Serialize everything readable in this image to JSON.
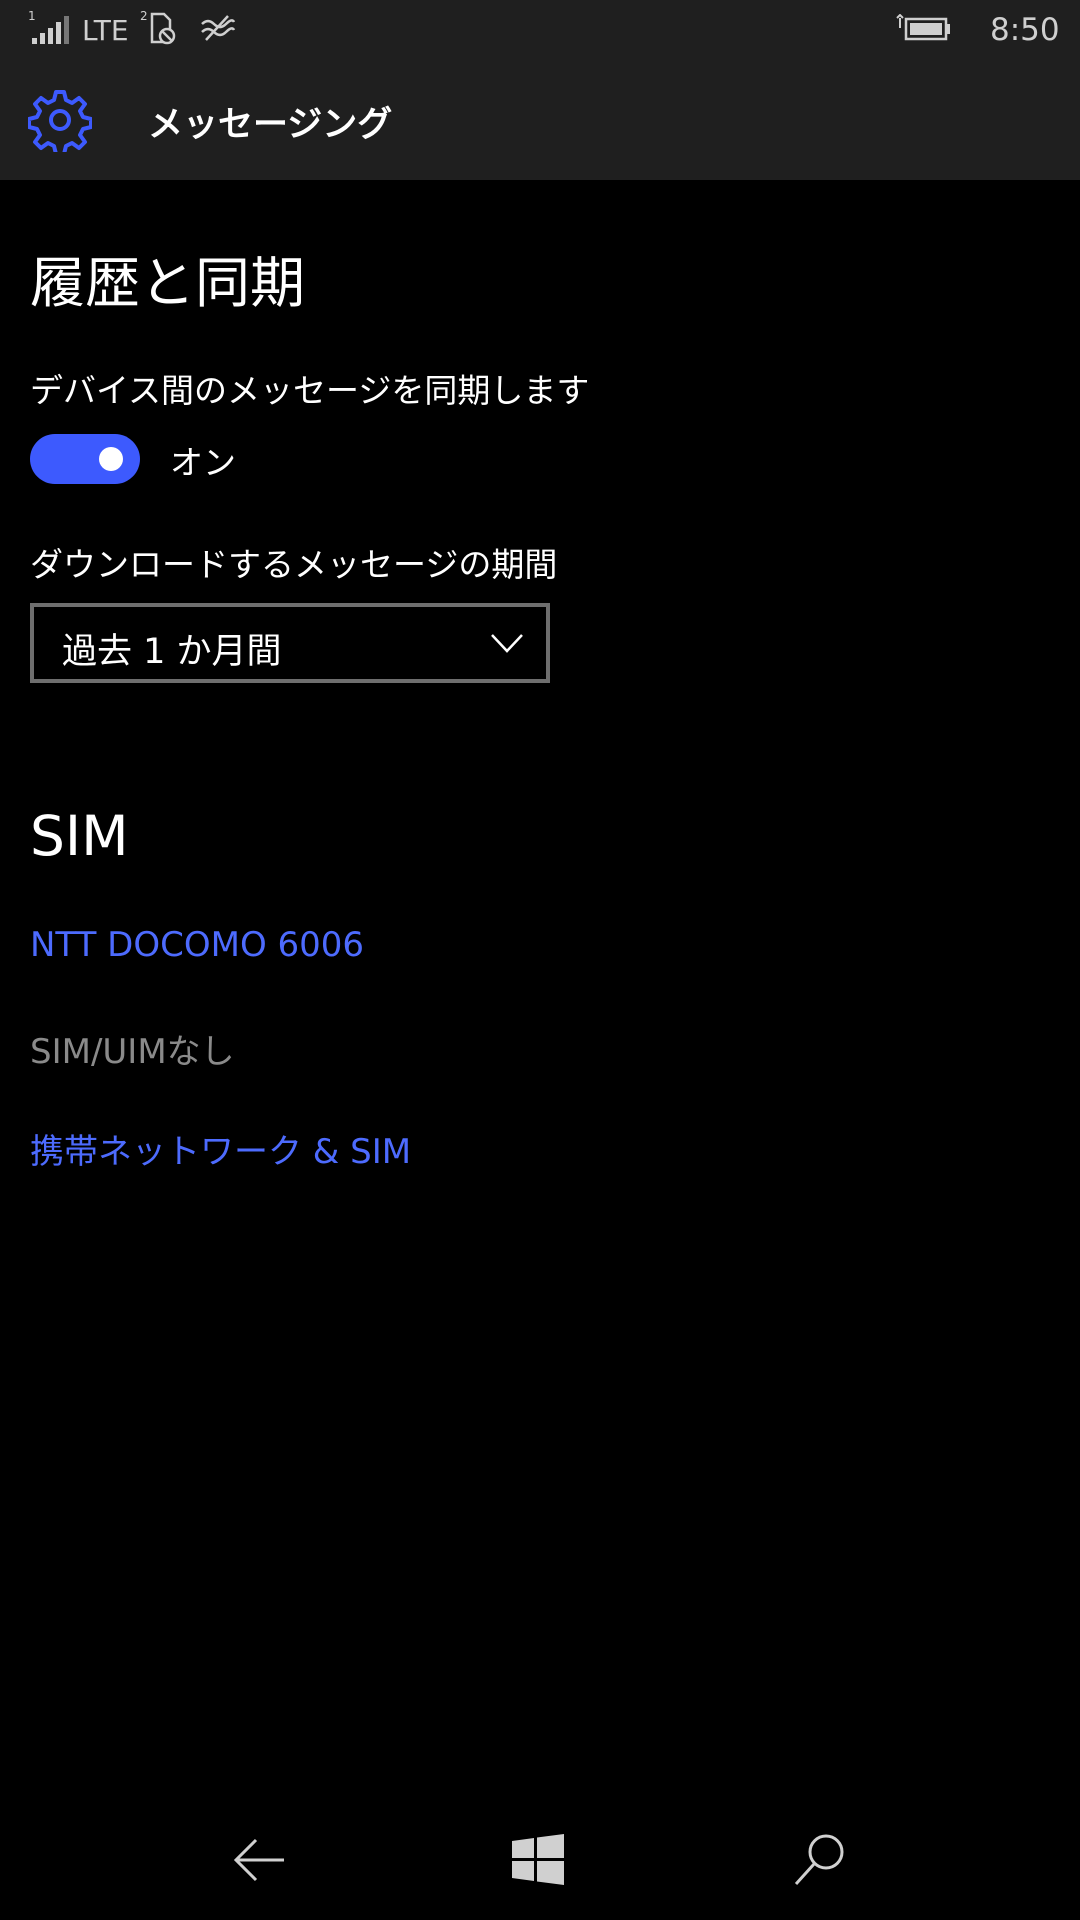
{
  "status_bar": {
    "sim1_indicator": "1",
    "network_type": "LTE",
    "sim2_indicator": "2",
    "time": "8:50",
    "icons": [
      "signal-icon",
      "sim2-icon",
      "wifi-off-icon",
      "battery-icon"
    ]
  },
  "header": {
    "title": "メッセージング",
    "icon": "gear-icon",
    "accent_color": "#3d5afe"
  },
  "history_sync": {
    "heading": "履歴と同期",
    "sync_label": "デバイス間のメッセージを同期します",
    "sync_state": "オン",
    "sync_on": true,
    "period_label": "ダウンロードするメッセージの期間",
    "period_value": "過去 1 か月間"
  },
  "sim": {
    "heading": "SIM",
    "carrier_link": "NTT DOCOMO 6006",
    "sim2_status": "SIM/UIMなし",
    "network_link": "携帯ネットワーク & SIM",
    "link_color": "#4d6bfe"
  },
  "nav_bar": {
    "icons": [
      "back-arrow-icon",
      "windows-logo-icon",
      "search-icon"
    ]
  }
}
